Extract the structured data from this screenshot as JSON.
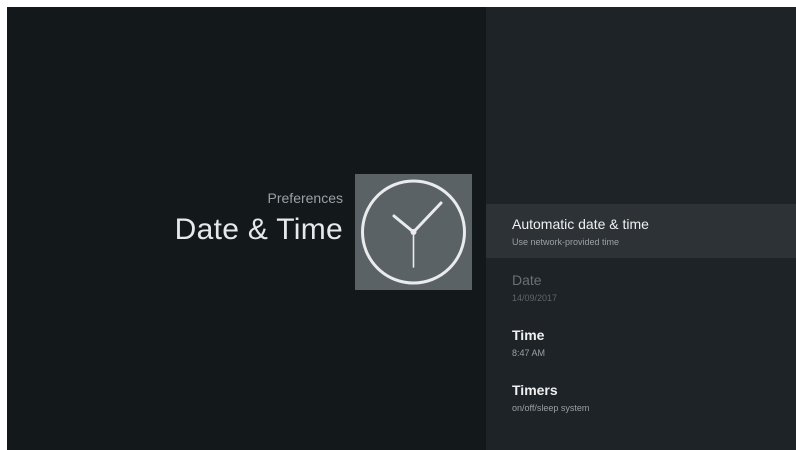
{
  "header": {
    "breadcrumb": "Preferences",
    "title": "Date & Time",
    "icon": "clock-icon"
  },
  "menu": {
    "items": [
      {
        "title": "Automatic date & time",
        "subtitle": "Use network-provided time",
        "focused": true,
        "enabled": true
      },
      {
        "title": "Date",
        "subtitle": "14/09/2017",
        "focused": false,
        "enabled": false
      },
      {
        "title": "Time",
        "subtitle": "8:47 AM",
        "focused": false,
        "enabled": true
      },
      {
        "title": "Timers",
        "subtitle": "on/off/sleep system",
        "focused": false,
        "enabled": true
      }
    ]
  },
  "colors": {
    "background": "#13181b",
    "panel": "#1e2327",
    "focus_highlight": "#2d3236",
    "icon_tile": "#5b6266"
  }
}
